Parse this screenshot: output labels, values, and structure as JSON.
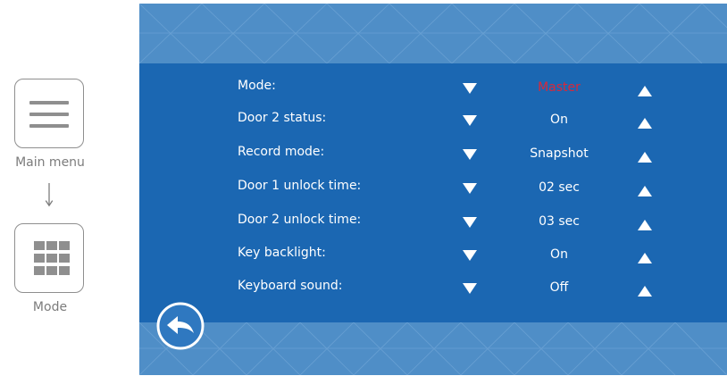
{
  "nav": {
    "main_menu_label": "Main menu",
    "mode_label": "Mode",
    "icons": [
      "menu-icon",
      "grid-icon",
      "arrow-down-icon"
    ]
  },
  "settings": {
    "rows": [
      {
        "label": "Mode:",
        "value": "Master",
        "highlight": true
      },
      {
        "label": "Door 2 status:",
        "value": "On"
      },
      {
        "label": "Record mode:",
        "value": "Snapshot"
      },
      {
        "label": "Door 1 unlock time:",
        "value": "02 sec"
      },
      {
        "label": "Door 2 unlock time:",
        "value": "03 sec"
      },
      {
        "label": "Key backlight:",
        "value": "On"
      },
      {
        "label": "Keyboard sound:",
        "value": "Off"
      }
    ],
    "decrease_icon": "triangle-down-icon",
    "increase_icon": "triangle-up-icon",
    "back_icon": "back-arrow-icon"
  },
  "colors": {
    "screen_bg": "#4f8ec7",
    "panel_bg": "#1b67b2",
    "text": "#ffffff",
    "highlight": "#d9283a",
    "nav_gray": "#8f8f8f"
  }
}
